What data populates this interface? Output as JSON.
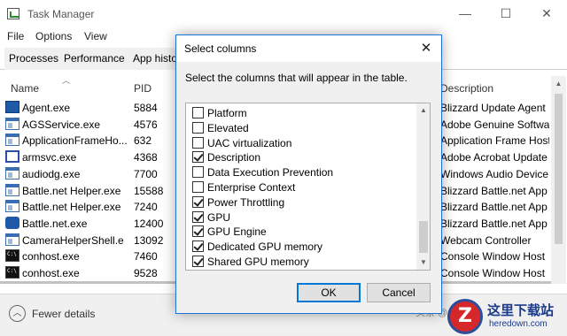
{
  "window": {
    "title": "Task Manager",
    "controls": {
      "minimize": "—",
      "maximize": "☐",
      "close": "✕"
    }
  },
  "menu": [
    "File",
    "Options",
    "View"
  ],
  "tabs": [
    "Processes",
    "Performance",
    "App histo"
  ],
  "columns": {
    "name": "Name",
    "pid": "PID",
    "description": "Description"
  },
  "processes": [
    {
      "name": "Agent.exe",
      "pid": "5884",
      "description": "Blizzard Update Agent",
      "icon": "blizzard-agent-icon"
    },
    {
      "name": "AGSService.exe",
      "pid": "4576",
      "description": "Adobe Genuine Software",
      "icon": "window-app-icon"
    },
    {
      "name": "ApplicationFrameHo...",
      "pid": "632",
      "description": "Application Frame Host",
      "icon": "window-app-icon"
    },
    {
      "name": "armsvc.exe",
      "pid": "4368",
      "description": "Adobe Acrobat Update S",
      "icon": "outline-window-icon"
    },
    {
      "name": "audiodg.exe",
      "pid": "7700",
      "description": "Windows Audio Device G",
      "icon": "window-app-icon"
    },
    {
      "name": "Battle.net Helper.exe",
      "pid": "15588",
      "description": "Blizzard Battle.net App B",
      "icon": "window-app-icon"
    },
    {
      "name": "Battle.net Helper.exe",
      "pid": "7240",
      "description": "Blizzard Battle.net App B",
      "icon": "window-app-icon"
    },
    {
      "name": "Battle.net.exe",
      "pid": "12400",
      "description": "Blizzard Battle.net App",
      "icon": "battlenet-icon"
    },
    {
      "name": "CameraHelperShell.e",
      "pid": "13092",
      "description": "Webcam Controller",
      "icon": "window-app-icon"
    },
    {
      "name": "conhost.exe",
      "pid": "7460",
      "description": "Console Window Host",
      "icon": "console-icon"
    },
    {
      "name": "conhost.exe",
      "pid": "9528",
      "description": "Console Window Host",
      "icon": "console-icon"
    }
  ],
  "footer": {
    "fewer_details": "Fewer details",
    "icon": "chevron-up-icon"
  },
  "dialog": {
    "title": "Select columns",
    "close": "✕",
    "instruction": "Select the columns that will appear in the table.",
    "columns": [
      {
        "label": "Platform",
        "checked": false
      },
      {
        "label": "Elevated",
        "checked": false
      },
      {
        "label": "UAC virtualization",
        "checked": false
      },
      {
        "label": "Description",
        "checked": true
      },
      {
        "label": "Data Execution Prevention",
        "checked": false
      },
      {
        "label": "Enterprise Context",
        "checked": false
      },
      {
        "label": "Power Throttling",
        "checked": true
      },
      {
        "label": "GPU",
        "checked": true
      },
      {
        "label": "GPU Engine",
        "checked": true
      },
      {
        "label": "Dedicated GPU memory",
        "checked": true
      },
      {
        "label": "Shared GPU memory",
        "checked": true
      }
    ],
    "ok": "OK",
    "cancel": "Cancel"
  },
  "watermark": {
    "small": "头条 @",
    "logo_letter": "Z",
    "cn_text": "这里下载站",
    "url": "heredown.com"
  }
}
